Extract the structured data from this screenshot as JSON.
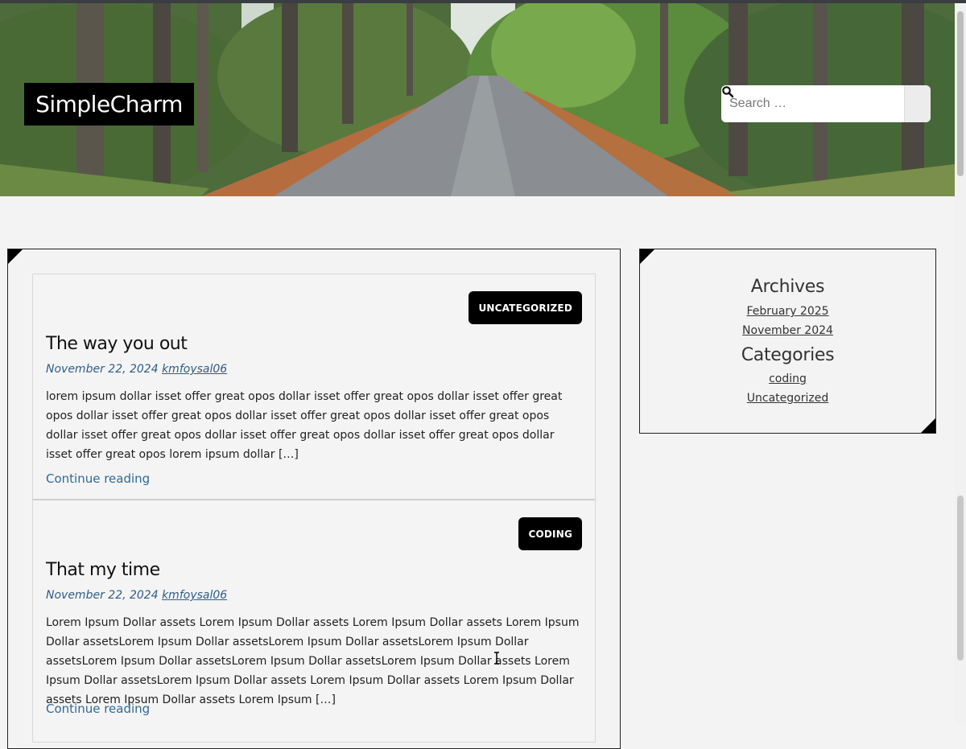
{
  "site": {
    "title": "SimpleCharm"
  },
  "search": {
    "placeholder": "Search …",
    "icon": "search-icon"
  },
  "posts": [
    {
      "category": "UNCATEGORIZED",
      "title": "The way you out",
      "date": "November 22, 2024",
      "author": "kmfoysal06",
      "excerpt": "lorem ipsum dollar isset offer great opos dollar isset offer great opos  dollar isset offer great opos dollar isset offer great opos  dollar isset offer great opos dollar isset offer great opos  dollar isset offer great opos  dollar isset offer great opos  dollar isset offer great opos dollar isset offer great opos lorem ipsum dollar […]",
      "continue": "Continue reading"
    },
    {
      "category": "CODING",
      "title": "That my time",
      "date": "November 22, 2024",
      "author": "kmfoysal06",
      "excerpt": "Lorem Ipsum Dollar assets Lorem Ipsum Dollar assets Lorem Ipsum Dollar assets Lorem Ipsum Dollar assetsLorem Ipsum Dollar assetsLorem Ipsum Dollar assetsLorem Ipsum Dollar assetsLorem Ipsum Dollar assetsLorem Ipsum Dollar assetsLorem Ipsum Dollar assets Lorem Ipsum Dollar assetsLorem Ipsum Dollar assets Lorem Ipsum Dollar assets Lorem Ipsum Dollar assets Lorem Ipsum Dollar assets Lorem Ipsum […]",
      "continue": "Continue reading"
    }
  ],
  "sidebar": {
    "archives_title": "Archives",
    "archives": [
      "February 2025",
      "November 2024"
    ],
    "categories_title": "Categories",
    "categories": [
      "coding",
      "Uncategorized"
    ]
  },
  "colors": {
    "accent_link": "#2e5d8c",
    "badge_bg": "#000000",
    "page_bg": "#f3f3f3"
  }
}
